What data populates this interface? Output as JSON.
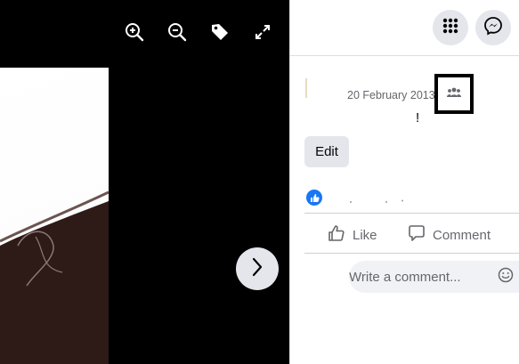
{
  "post": {
    "date": "20 February 2013",
    "text": "!",
    "edit_label": "Edit"
  },
  "actions": {
    "like_label": "Like",
    "comment_label": "Comment"
  },
  "comment": {
    "placeholder": "Write a comment..."
  },
  "colors": {
    "accent": "#1877f2",
    "secondary_text": "#65676b",
    "button_bg": "#e4e6eb",
    "viewer_bg": "#000000"
  },
  "icons": {
    "viewer_tools": [
      "zoom-in-icon",
      "zoom-out-icon",
      "tag-icon",
      "fullscreen-icon"
    ],
    "top_bar": [
      "menu-grid-icon",
      "messenger-icon"
    ],
    "audience": "friends-icon",
    "navigation": "chevron-right-icon"
  }
}
